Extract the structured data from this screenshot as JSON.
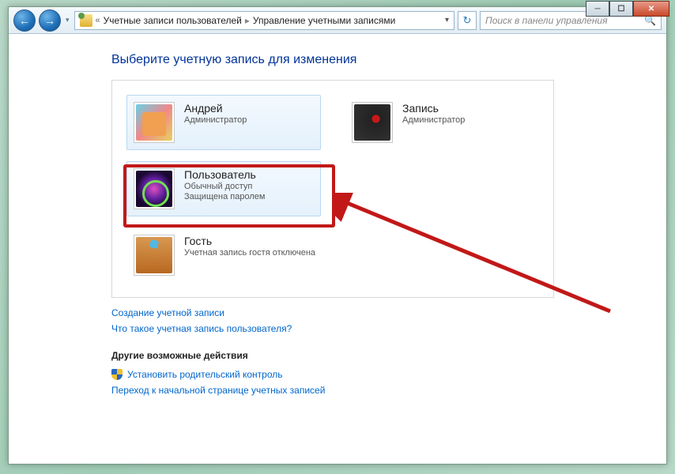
{
  "titlebar": {
    "minimize": "─",
    "maximize": "☐",
    "close": "✕"
  },
  "nav": {
    "back": "←",
    "forward": "→",
    "dropdown": "▾"
  },
  "breadcrumb": {
    "chevron_left": "«",
    "item1": "Учетные записи пользователей",
    "item2": "Управление учетными записями",
    "sep": "▸",
    "end_chevron": "▾"
  },
  "refresh": "↻",
  "search": {
    "placeholder": "Поиск в панели управления",
    "icon": "🔍"
  },
  "page": {
    "title": "Выберите учетную запись для изменения"
  },
  "accounts": [
    {
      "name": "Андрей",
      "sub1": "Администратор",
      "sub2": ""
    },
    {
      "name": "Запись",
      "sub1": "Администратор",
      "sub2": ""
    },
    {
      "name": "Пользователь",
      "sub1": "Обычный доступ",
      "sub2": "Защищена паролем"
    },
    {
      "name": "Гость",
      "sub1": "Учетная запись гостя отключена",
      "sub2": ""
    }
  ],
  "links": {
    "create": "Создание учетной записи",
    "what": "Что такое учетная запись пользователя?"
  },
  "other": {
    "heading": "Другие возможные действия",
    "parental": "Установить родительский контроль",
    "homepage": "Переход к начальной странице учетных записей"
  }
}
